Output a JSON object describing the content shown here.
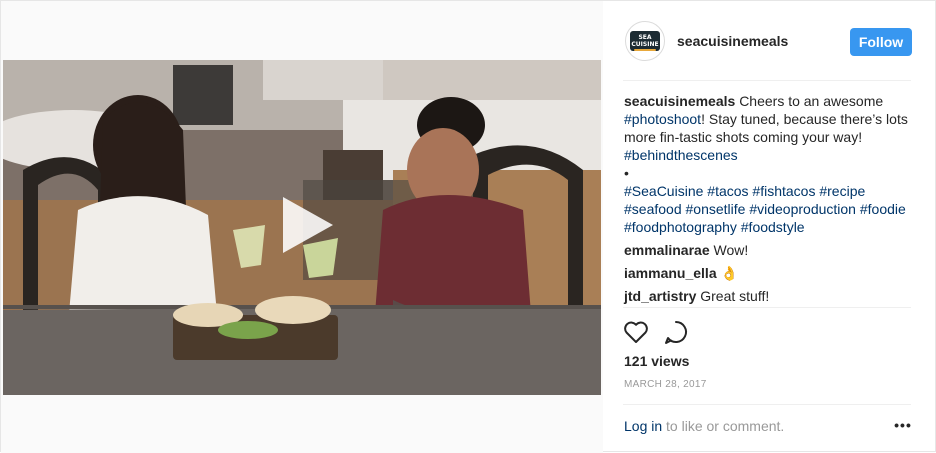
{
  "account": {
    "username": "seacuisinemeals",
    "avatar_logo_text": "SEA CUISINE"
  },
  "header": {
    "follow_label": "Follow"
  },
  "caption": {
    "username": "seacuisinemeals",
    "text_1": "Cheers to an awesome ",
    "hashtag_1": "#photoshoot",
    "text_2": "! Stay tuned, because there’s lots more fin-tastic shots coming your way! ",
    "hashtag_2": "#behindthescenes",
    "bullet": "•",
    "hashtags": [
      "#SeaCuisine",
      "#tacos",
      "#fishtacos",
      "#recipe",
      "#seafood",
      "#onsetlife",
      "#videoproduction",
      "#foodie",
      "#foodphotography",
      "#foodstyle"
    ]
  },
  "comments": [
    {
      "user": "emmalinarae",
      "text": "Wow!"
    },
    {
      "user": "iammanu_ella",
      "text": "👌"
    },
    {
      "user": "jtd_artistry",
      "text": "Great stuff!"
    }
  ],
  "actions": {
    "like_icon": "heart-icon",
    "comment_icon": "comment-bubble-icon"
  },
  "stats": {
    "views": "121 views",
    "date": "MARCH 28, 2017"
  },
  "footer": {
    "login_label": "Log in",
    "login_suffix": " to like or comment.",
    "more_label": "•••"
  },
  "colors": {
    "follow_button": "#3897f0",
    "link": "#003569",
    "muted": "#999999"
  }
}
